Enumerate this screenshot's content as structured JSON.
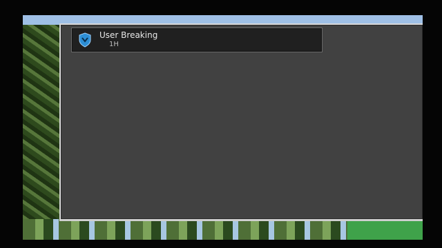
{
  "screen": {
    "title_text": "",
    "toast": {
      "title": "User Breaking",
      "subtitle": "1H",
      "icon": "shield-icon",
      "icon_color": "#2d8fd6"
    }
  },
  "colors": {
    "panel": "#414141",
    "toast_bg": "#202020",
    "frame_bg": "#3d5a2a"
  }
}
